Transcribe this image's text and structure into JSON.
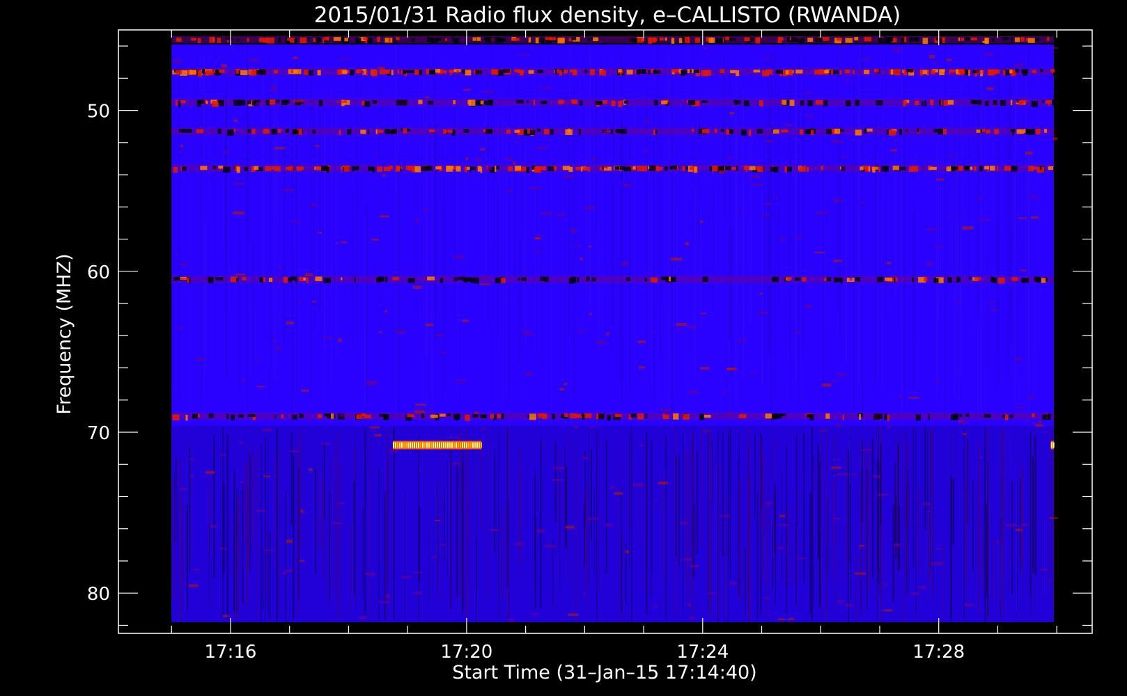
{
  "chart_data": {
    "type": "heatmap",
    "title": "2015/01/31  Radio flux density, e–CALLISTO (RWANDA)",
    "xlabel": "Start Time (31–Jan–15 17:14:40)",
    "ylabel": "Frequency (MHZ)",
    "x_tick_labels": [
      "17:16",
      "17:20",
      "17:24",
      "17:28"
    ],
    "x_ticks_minutes": [
      16,
      20,
      24,
      28
    ],
    "y_tick_labels": [
      "50",
      "60",
      "70",
      "80"
    ],
    "y_ticks": [
      50,
      60,
      70,
      80
    ],
    "xlim_minutes_after_1700": [
      14.1,
      30.6
    ],
    "ylim_mhz": [
      45.0,
      82.5
    ],
    "data_start_minute": 15.0,
    "data_end_minute": 29.95,
    "data_freq_range_mhz": [
      45.9,
      81.8
    ],
    "y_reversed": true,
    "colormap": [
      "#000000",
      "#1a00c8",
      "#2a00ff",
      "#8a0090",
      "#ff2000",
      "#ff9900",
      "#ffff80"
    ],
    "background_level": "blue",
    "persistent_bands_mhz": [
      {
        "freq": 45.6,
        "intensity": 0.65
      },
      {
        "freq": 47.6,
        "intensity": 0.85
      },
      {
        "freq": 49.5,
        "intensity": 0.45
      },
      {
        "freq": 51.3,
        "intensity": 0.45
      },
      {
        "freq": 53.6,
        "intensity": 0.8
      },
      {
        "freq": 60.5,
        "intensity": 0.4
      },
      {
        "freq": 69.0,
        "intensity": 0.45
      }
    ],
    "bursts": [
      {
        "t_start": 18.75,
        "t_end": 20.25,
        "freq": 70.8,
        "peak": "yellow"
      },
      {
        "t_start": 29.9,
        "t_end": 29.95,
        "freq": 70.8,
        "peak": "yellow"
      }
    ],
    "grid": false
  }
}
